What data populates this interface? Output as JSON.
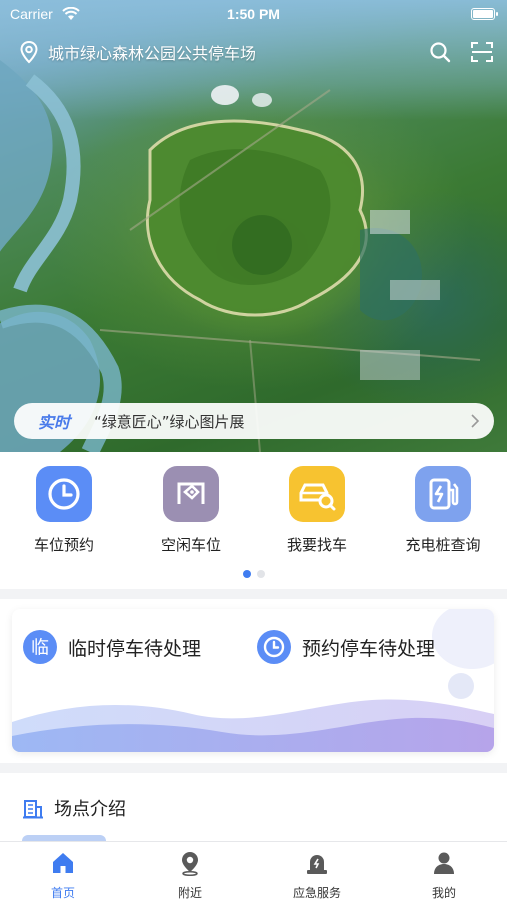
{
  "status_bar": {
    "carrier": "Carrier",
    "time": "1:50 PM"
  },
  "header": {
    "location_title": "城市绿心森林公园公共停车场"
  },
  "news": {
    "tag": "实时",
    "text": "“绿意匠心”绿心图片展"
  },
  "quick_actions": [
    {
      "label": "车位预约",
      "icon": "clock-icon",
      "color": "#5b8df6"
    },
    {
      "label": "空闲车位",
      "icon": "parking-spot-icon",
      "color": "#9b8fb2"
    },
    {
      "label": "我要找车",
      "icon": "car-search-icon",
      "color": "#f7c330"
    },
    {
      "label": "充电桩查询",
      "icon": "charging-station-icon",
      "color": "#7ea2ee"
    }
  ],
  "pager": {
    "pages": 2,
    "active": 0
  },
  "pending": [
    {
      "label": "临时停车待处理",
      "icon": "temp-parking-icon",
      "icon_text": "临"
    },
    {
      "label": "预约停车待处理",
      "icon": "clock-icon"
    }
  ],
  "intro": {
    "title": "场点介绍",
    "icon": "building-icon"
  },
  "tabbar": [
    {
      "label": "首页",
      "icon": "home-icon",
      "active": true
    },
    {
      "label": "附近",
      "icon": "location-pin-icon",
      "active": false
    },
    {
      "label": "应急服务",
      "icon": "emergency-light-icon",
      "active": false
    },
    {
      "label": "我的",
      "icon": "user-icon",
      "active": false
    }
  ],
  "colors": {
    "accent": "#3f7cf0",
    "news_tag": "#4a7bea"
  }
}
